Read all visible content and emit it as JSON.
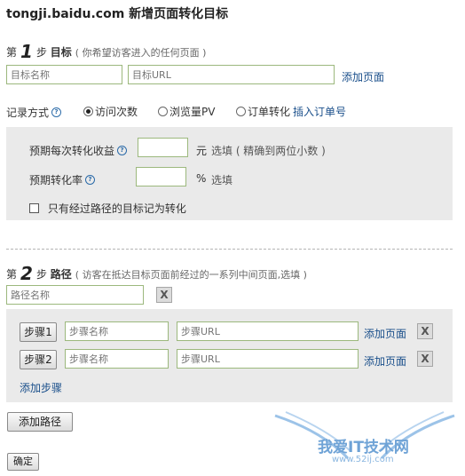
{
  "header": {
    "domain": "tongji.baidu.com",
    "title": "新增页面转化目标"
  },
  "step1": {
    "prefix": "第",
    "number": "1",
    "suffix": "步",
    "label": "目标",
    "hint": "( 你希望访客进入的任何页面 )",
    "name_placeholder": "目标名称",
    "url_placeholder": "目标URL",
    "add_page": "添加页面"
  },
  "record": {
    "label": "记录方式",
    "options": [
      "访问次数",
      "浏览量PV",
      "订单转化"
    ],
    "selected": "访问次数",
    "insert_order": "插入订单号"
  },
  "expect": {
    "revenue_label": "预期每次转化收益",
    "revenue_unit": "元",
    "revenue_note": "选填 ( 精确到两位小数 )",
    "rate_label": "预期转化率",
    "rate_unit": "%",
    "rate_note": "选填",
    "only_path_label": "只有经过路径的目标记为转化"
  },
  "step2": {
    "prefix": "第",
    "number": "2",
    "suffix": "步",
    "label": "路径",
    "hint": "( 访客在抵达目标页面前经过的一系列中间页面,选填 )",
    "path_name_placeholder": "路径名称",
    "remove": "X",
    "steps": [
      {
        "button": "步骤1",
        "name_placeholder": "步骤名称",
        "url_placeholder": "步骤URL",
        "add_page": "添加页面",
        "remove": "X"
      },
      {
        "button": "步骤2",
        "name_placeholder": "步骤名称",
        "url_placeholder": "步骤URL",
        "add_page": "添加页面",
        "remove": "X"
      }
    ],
    "add_step": "添加步骤"
  },
  "actions": {
    "add_path": "添加路径",
    "confirm": "确定"
  },
  "watermark": {
    "title": "我爱IT技术网",
    "url": "www.52ij.com"
  }
}
